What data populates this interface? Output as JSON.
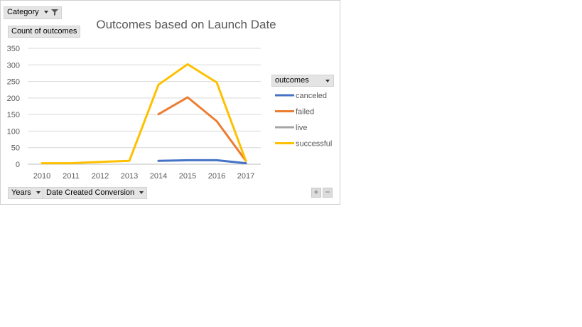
{
  "field_buttons": {
    "category": "Category",
    "values": "Count of outcomes",
    "legend_field": "outcomes",
    "axis_years": "Years",
    "axis_date": "Date Created Conversion"
  },
  "zoom_controls": {
    "plus": "+",
    "minus": "−"
  },
  "chart_data": {
    "type": "line",
    "title": "Outcomes based on Launch Date",
    "categories": [
      "2010",
      "2011",
      "2012",
      "2013",
      "2014",
      "2015",
      "2016",
      "2017"
    ],
    "ylim": [
      0,
      350
    ],
    "yticks": [
      0,
      50,
      100,
      150,
      200,
      250,
      300,
      350
    ],
    "grid": true,
    "legend_position": "right",
    "series": [
      {
        "name": "canceled",
        "color": "#4472c4",
        "values": [
          null,
          null,
          null,
          null,
          10,
          12,
          12,
          3
        ]
      },
      {
        "name": "failed",
        "color": "#ed7d31",
        "values": [
          null,
          null,
          null,
          null,
          151,
          202,
          130,
          10
        ]
      },
      {
        "name": "live",
        "color": "#a5a5a5",
        "values": [
          null,
          null,
          null,
          null,
          null,
          null,
          null,
          null
        ]
      },
      {
        "name": "successful",
        "color": "#ffc000",
        "values": [
          3,
          3,
          7,
          10,
          240,
          302,
          247,
          10
        ]
      }
    ]
  }
}
